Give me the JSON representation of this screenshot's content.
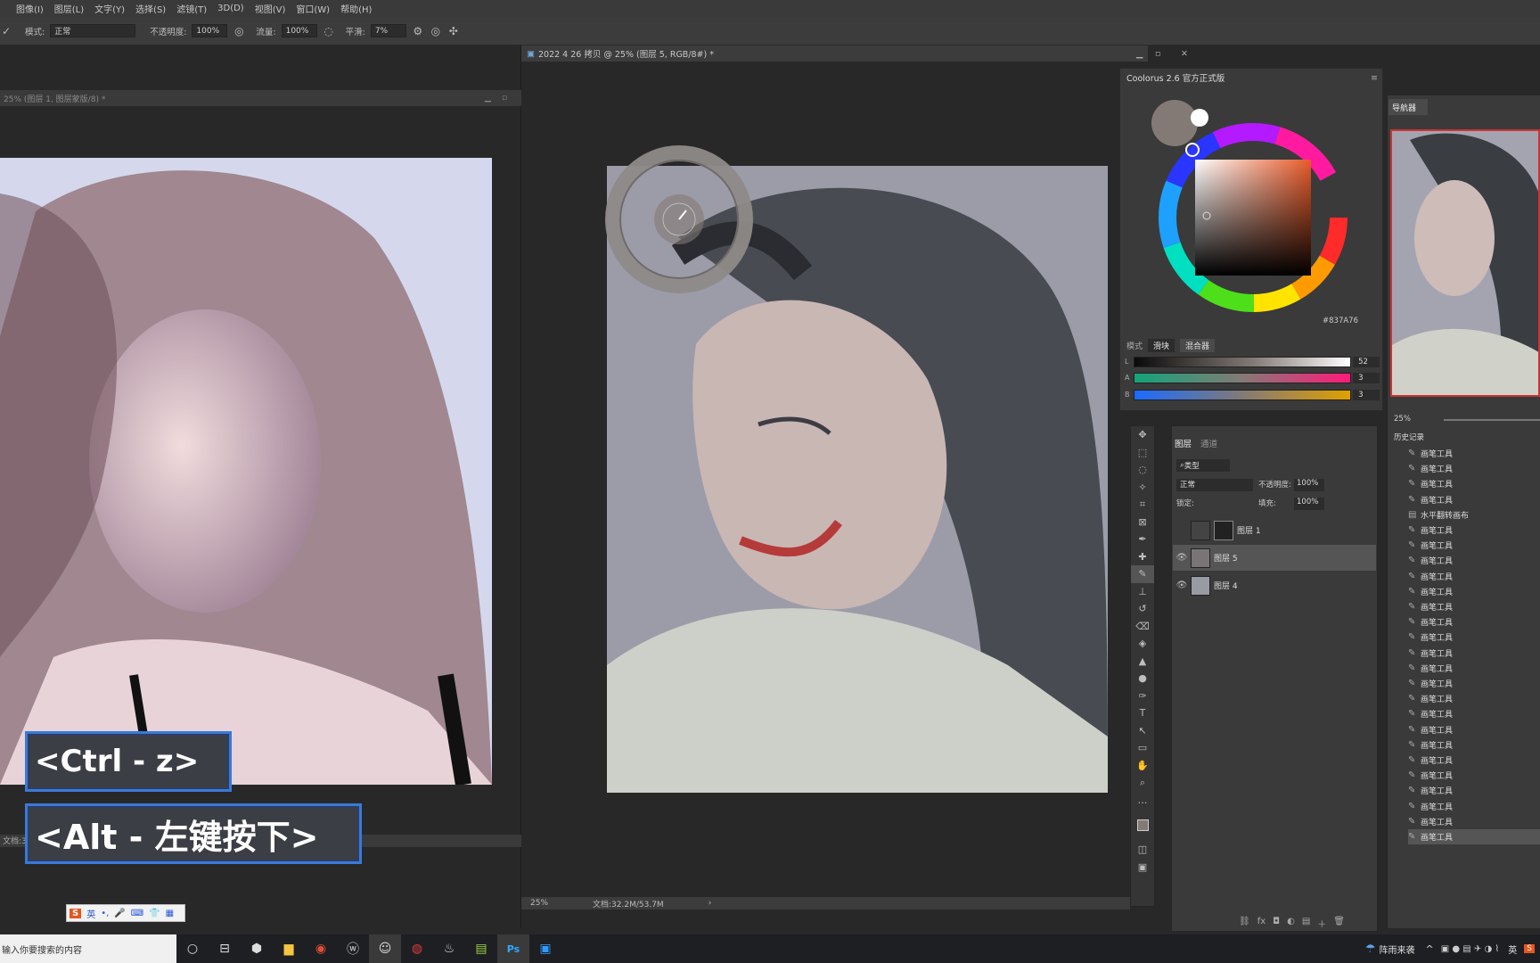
{
  "menubar": {
    "items": [
      "图像(I)",
      "图层(L)",
      "文字(Y)",
      "选择(S)",
      "滤镜(T)",
      "3D(D)",
      "视图(V)",
      "窗口(W)",
      "帮助(H)"
    ]
  },
  "options": {
    "mode_label": "模式:",
    "mode_value": "正常",
    "opacity_label": "不透明度:",
    "opacity_value": "100%",
    "flow_label": "流量:",
    "flow_value": "100%",
    "smooth_label": "平滑:",
    "smooth_value": "7%"
  },
  "doc_left": {
    "title": "25% (图层 1, 图层蒙版/8) *",
    "status": "文档:3"
  },
  "doc_main": {
    "title": "2022 4 26 拷贝 @ 25% (图层 5, RGB/8#) *",
    "zoom": "25%",
    "doc_size": "文档:32.2M/53.7M"
  },
  "coloring": {
    "title": "Coolorus 2.6 官方正式版",
    "hex": "#837A76",
    "mode_label": "模式",
    "tab1": "滑块",
    "tab2": "混合器",
    "sliders": [
      {
        "label": "L",
        "value": "52"
      },
      {
        "label": "A",
        "value": "3"
      },
      {
        "label": "B",
        "value": "3"
      }
    ]
  },
  "layers": {
    "tab_layers": "图层",
    "tab_channels": "通道",
    "kind_label": "类型",
    "blend": "正常",
    "opacity_label": "不透明度:",
    "opacity": "100%",
    "lock_label": "锁定:",
    "fill_label": "填充:",
    "fill": "100%",
    "rows": [
      {
        "name": "图层 1"
      },
      {
        "name": "图层 5"
      },
      {
        "name": "图层 4"
      }
    ]
  },
  "navigator": {
    "title": "导航器",
    "zoom": "25%"
  },
  "history": {
    "title": "历史记录",
    "items": [
      "画笔工具",
      "画笔工具",
      "画笔工具",
      "画笔工具",
      "水平翻转画布",
      "画笔工具",
      "画笔工具",
      "画笔工具",
      "画笔工具",
      "画笔工具",
      "画笔工具",
      "画笔工具",
      "画笔工具",
      "画笔工具",
      "画笔工具",
      "画笔工具",
      "画笔工具",
      "画笔工具",
      "画笔工具",
      "画笔工具",
      "画笔工具",
      "画笔工具",
      "画笔工具",
      "画笔工具",
      "画笔工具",
      "画笔工具"
    ]
  },
  "overlays": {
    "shortcut1": "<Ctrl - z>",
    "shortcut2": "<Alt - 左键按下>"
  },
  "ime": {
    "label": "英"
  },
  "taskbar": {
    "search_placeholder": "输入你要搜索的内容",
    "weather": "阵雨来袭",
    "lang": "英"
  }
}
